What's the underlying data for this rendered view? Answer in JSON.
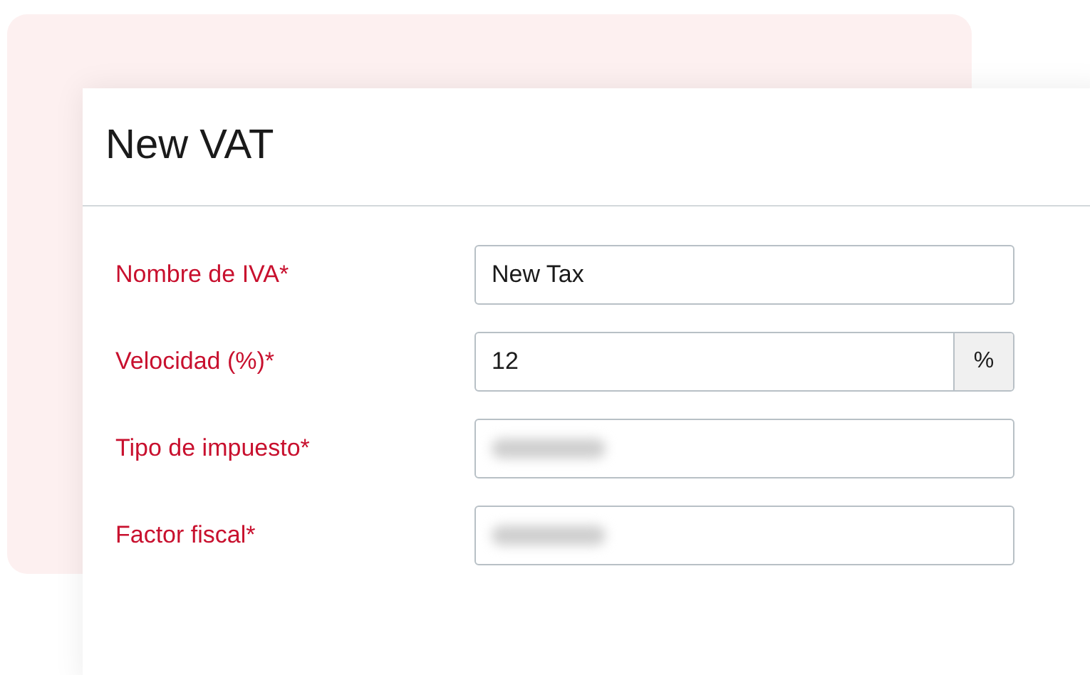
{
  "dialog": {
    "title": "New VAT"
  },
  "fields": [
    {
      "label": "Nombre de IVA*",
      "value": "New Tax",
      "blurred": false
    },
    {
      "label": "Velocidad (%)*",
      "value": "12",
      "suffix": "%",
      "blurred": false
    },
    {
      "label": "Tipo de impuesto*",
      "blurred": true
    },
    {
      "label": "Factor fiscal*",
      "blurred": true
    }
  ]
}
